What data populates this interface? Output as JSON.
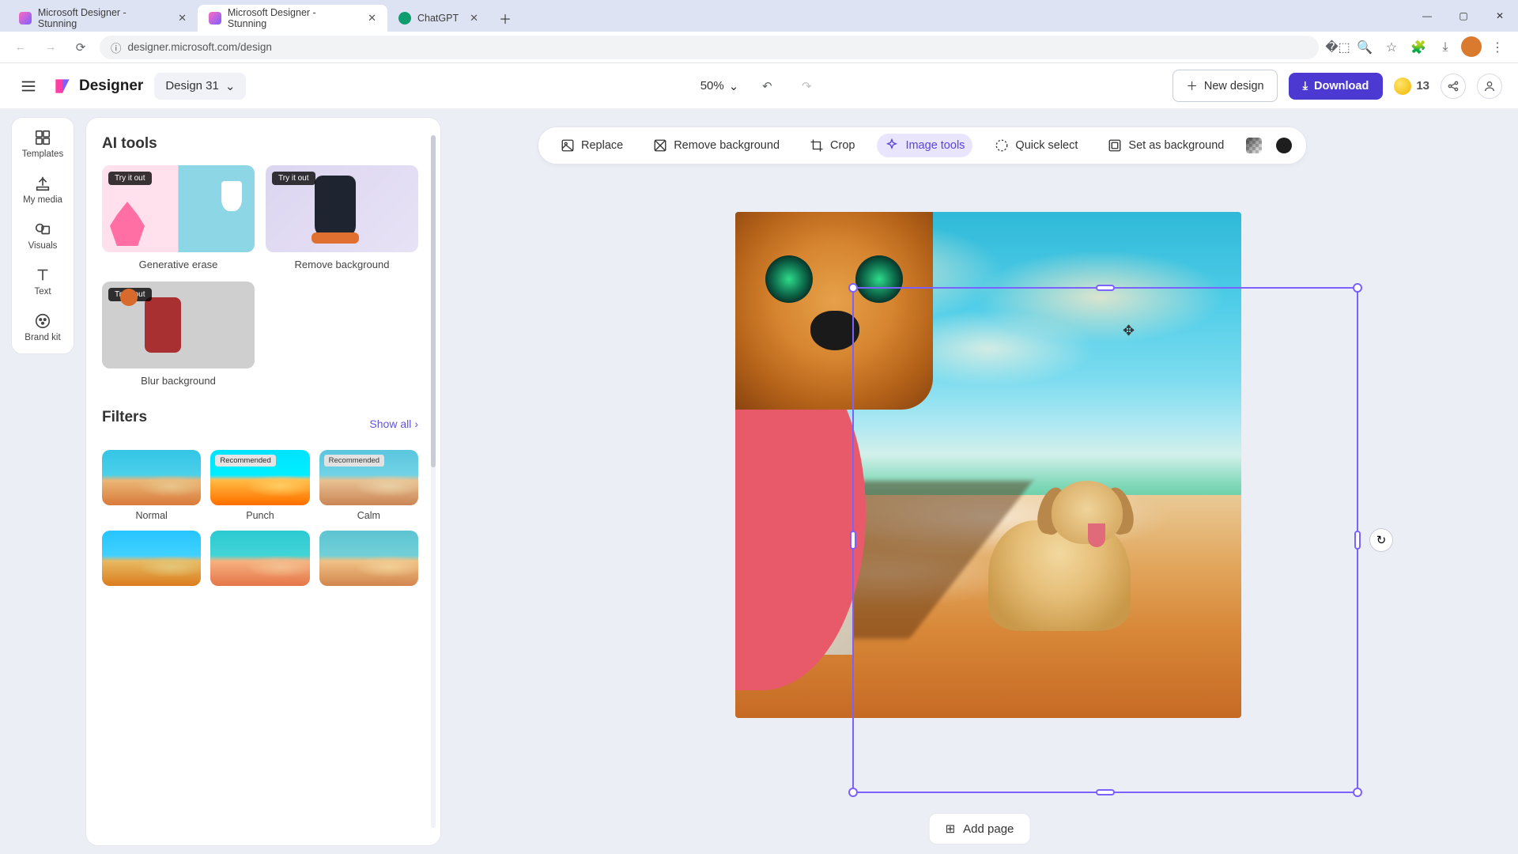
{
  "browser": {
    "tabs": [
      {
        "title": "Microsoft Designer - Stunning"
      },
      {
        "title": "Microsoft Designer - Stunning"
      },
      {
        "title": "ChatGPT"
      }
    ],
    "url": "designer.microsoft.com/design"
  },
  "header": {
    "brand": "Designer",
    "design_name": "Design 31",
    "zoom": "50%",
    "new_design": "New design",
    "download": "Download",
    "credits": "13"
  },
  "rail": {
    "templates": "Templates",
    "my_media": "My media",
    "visuals": "Visuals",
    "text": "Text",
    "brand_kit": "Brand kit"
  },
  "panel": {
    "ai_tools_title": "AI tools",
    "try_badge": "Try it out",
    "recommended_badge": "Recommended",
    "tools": {
      "generative_erase": "Generative erase",
      "remove_background": "Remove background",
      "blur_background": "Blur background"
    },
    "filters_title": "Filters",
    "show_all": "Show all",
    "filters": {
      "normal": "Normal",
      "punch": "Punch",
      "calm": "Calm"
    }
  },
  "ctx": {
    "replace": "Replace",
    "remove_bg": "Remove background",
    "crop": "Crop",
    "image_tools": "Image tools",
    "quick_select": "Quick select",
    "set_bg": "Set as background"
  },
  "footer": {
    "add_page": "Add page"
  }
}
